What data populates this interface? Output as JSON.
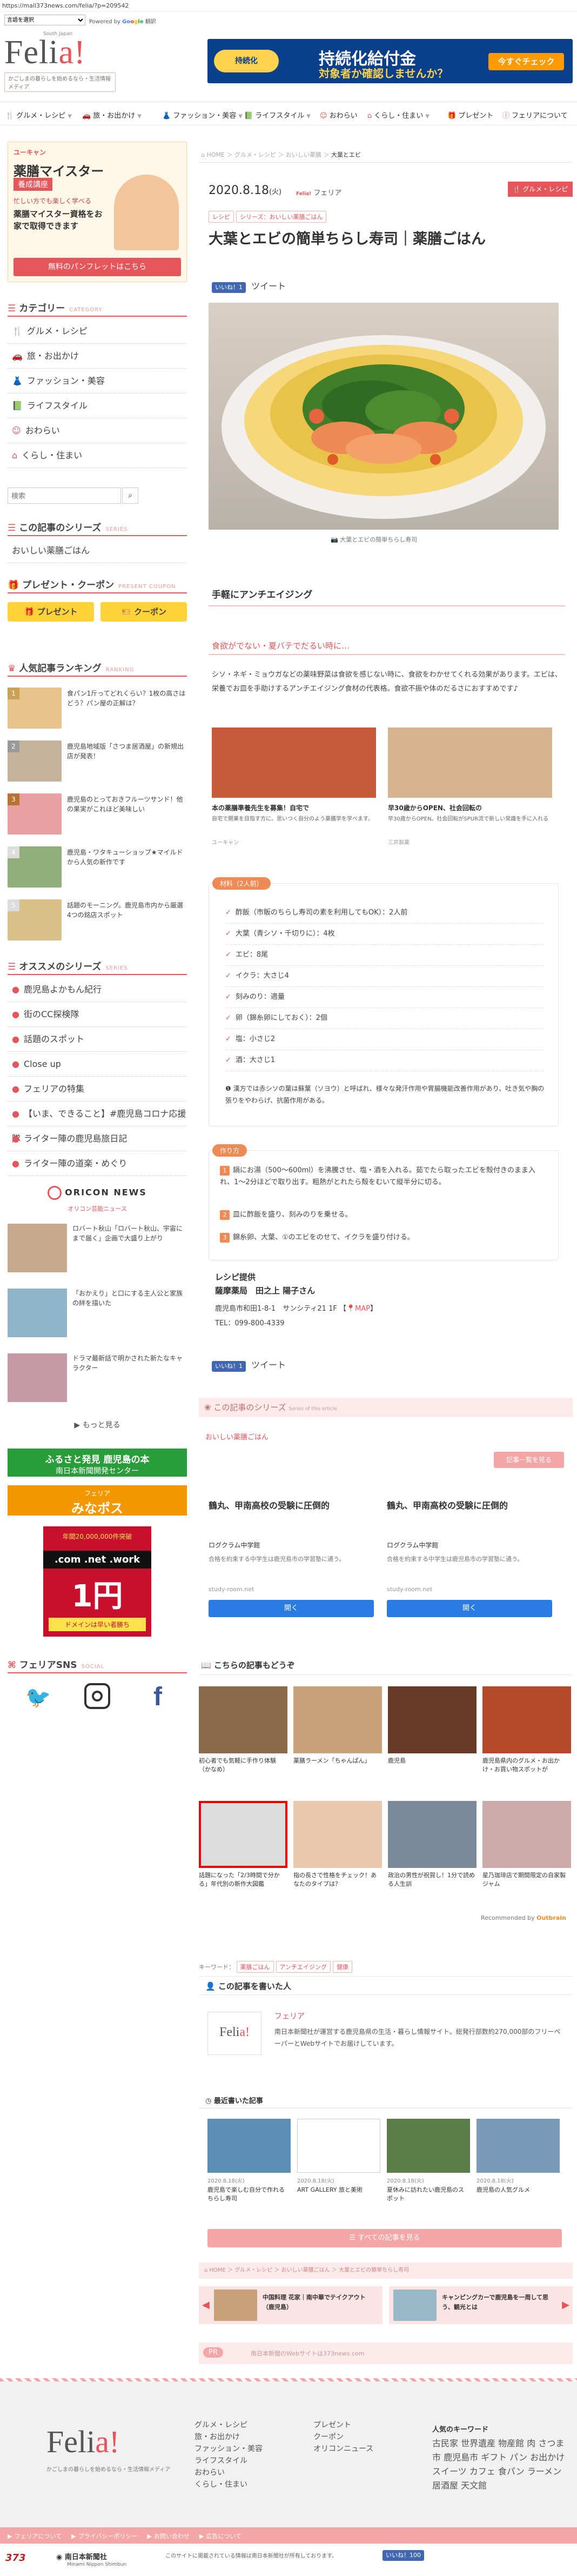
{
  "browser": {
    "url": "https://mall373news.com/felia/?p=209542"
  },
  "lang": {
    "selected": "言語を選択",
    "powered": "Powered by",
    "translate": "翻訳"
  },
  "header": {
    "logo_text_main": "Feli",
    "logo_text_accent": "a!",
    "logo_small": "South Japan",
    "tagline": "かごしまの暮らしを始めるなら・生活情報メディア",
    "ad": {
      "badge": "持続化",
      "title": "持続化給付金",
      "subtitle": "対象者か確認しませんか？",
      "cta": "今すぐチェック"
    }
  },
  "nav": [
    {
      "label": "グルメ・レシピ"
    },
    {
      "label": "旅・お出かけ"
    },
    {
      "label": "ファッション・美容"
    },
    {
      "label": "ライフスタイル"
    },
    {
      "label": "おわらい"
    },
    {
      "label": "くらし・住まい"
    },
    {
      "label": "プレゼント"
    },
    {
      "label": "フェリアについて"
    }
  ],
  "sidebar": {
    "ad1": {
      "brand": "ユーキャン",
      "title": "薬膳マイスター",
      "sub": "養成講座",
      "catch": "忙しい方でも楽しく学べる",
      "line": "薬膳マイスター資格をお家で取得できます",
      "cta": "無料のパンフレットはこちら"
    },
    "category_title": "カテゴリー",
    "category_sub": "CATEGORY",
    "categories": [
      "グルメ・レシピ",
      "旅・お出かけ",
      "ファッション・美容",
      "ライフスタイル",
      "おわらい",
      "くらし・住まい"
    ],
    "search_placeholder": "検索",
    "series_title": "この記事のシリーズ",
    "series_sub": "SERIES",
    "series_items": [
      "おいしい薬膳ごはん"
    ],
    "present_title": "プレゼント・クーポン",
    "present_sub": "PRESENT COUPON",
    "present_btn": "プレゼント",
    "coupon_btn": "クーポン",
    "ranking_title": "人気記事ランキング",
    "ranking_sub": "RANKING",
    "ranking": [
      {
        "rank": "1",
        "text": "食パン1斤ってどれくらい？1枚の高さはどう？パン屋の正解は？"
      },
      {
        "rank": "2",
        "text": "鹿児島地域版「さつま居酒屋」の新規出店が発表！"
      },
      {
        "rank": "3",
        "text": "鹿児島のとっておきフルーツサンド！他の果実がこれほど美味しい"
      },
      {
        "rank": "4",
        "text": "鹿児島・ワタキューショップ★マイルドから人気の新作です"
      },
      {
        "rank": "5",
        "text": "話題のモーニング。鹿児島市内から厳選4つの銘店スポット"
      }
    ],
    "series_rec_title": "オススメのシリーズ",
    "series_rec_sub": "SERIES",
    "series_rec": [
      "鹿児島よかもん紀行",
      "街のCC探検隊",
      "話題のスポット",
      "Close up",
      "フェリアの特集",
      "【いま、できること】#鹿児島コロナ応援隊",
      "ライター陣の鹿児島旅日記",
      "ライター陣の道楽・めぐり"
    ],
    "oricon_title": "ORICON NEWS",
    "oricon_sub": "オリコン芸能ニュース",
    "oricon": [
      {
        "text": "ロバート秋山「ロバート秋山、宇宙にまで届く」企画で大盛り上がり"
      },
      {
        "text": "「おかえり」と口にする主人公と家族の絆を描いた"
      },
      {
        "text": "ドラマ最新話で明かされた新たなキャラクター"
      }
    ],
    "more": "もっと見る",
    "banner1": {
      "line1": "ふるさと発見 鹿児島の本",
      "line2": "南日本新聞開発センター"
    },
    "banner2": {
      "line1": "フェリア",
      "line2": "みなポス"
    },
    "banner3": {
      "line1": "年間20,000,000件突破",
      "line2": ".com .net .work",
      "line3": "1円",
      "line4": "ドメインは早い者勝ち"
    },
    "sns_title": "フェリアSNS",
    "sns_sub": "SOCIAL"
  },
  "article": {
    "breadcrumb": [
      "HOME",
      "グルメ・レシピ",
      "おいしい薬膳",
      "大葉とエビ"
    ],
    "date": "2020.8.18",
    "dow": "(火)",
    "author": "フェリア",
    "badge": "グルメ・レシピ",
    "tags_top": [
      "レシピ",
      "シリーズ：おいしい薬膳ごはん"
    ],
    "title": "大葉とエビの簡単ちらし寿司｜薬膳ごはん",
    "like": "いいね！1",
    "tweet": "ツイート",
    "image_caption": "大葉とエビの簡単ちらし寿司",
    "section_title": "手軽にアンチエイジング",
    "intro_heading": "食欲がでない・夏バテでだるい時に…",
    "intro": "シソ・ネギ・ミョウガなどの薬味野菜は食欲を感じない時に、食欲をわかせてくれる効果があります。エビは、栄養でお皿を手助けするアンチエイジング食材の代表格。食欲不振や体のだるさにおすすめです♪",
    "ad_cards": [
      {
        "title": "本の薬膳準養先生を募集！自宅で",
        "text": "自宅で開業を目指す方に。思いつく自分のよう薬膳学を学べます。",
        "src": "ユーキャン"
      },
      {
        "title": "早30歳からOPEN、社会回転の",
        "text": "早30歳からOPEN。社会回転がSPUR流で新しい常識を手に入れる",
        "src": "三井製薬"
      }
    ],
    "ingredients_label": "材料（2人前）",
    "ingredients": [
      "酢飯（市販のちらし寿司の素を利用してもOK）：2人前",
      "大葉（青シソ・千切りに）：4枚",
      "エビ：8尾",
      "イクラ：大さじ4",
      "刻みのり：適量",
      "卵（錦糸卵にしておく）：2個",
      "塩：小さじ2",
      "酒：大さじ1"
    ],
    "note": "漢方では赤シソの葉は蘇葉（ソヨウ）と呼ばれ、様々な発汗作用や胃腸機能改善作用があり、吐き気や胸の張りをやわらげ、抗菌作用がある。",
    "steps_label": "作り方",
    "steps": [
      "鍋にお湯（500〜600ml）を沸騰させ、塩・酒を入れる。茹でたら取ったエビを殻付きのまま入れ、1〜2分ほどで取り出す。粗熱がとれたら殻をむいて縦半分に切る。",
      "皿に酢飯を盛り、刻みのりを乗せる。",
      "錦糸卵、大葉、①のエビをのせて、イクラを盛り付ける。"
    ],
    "provider_label": "レシピ提供",
    "provider": "薩摩薬局　田之上 陽子さん",
    "address": "鹿児島市和田1-8-1　サンシティ21 1F",
    "map": "MAP",
    "tel": "TEL：099-800-4339",
    "series_bar": "この記事のシリーズ",
    "series_bar_sub": "Series of this article",
    "series_name": "おいしい薬膳ごはん",
    "series_btn": "記事一覧を見る",
    "ads2": [
      {
        "title": "鶴丸、甲南高校の受験に圧倒的",
        "sub": "ログクラム中学館",
        "text": "合格を約束する中学生は鹿児島市の学習塾に通う。",
        "src": "study-room.net",
        "cta": "開く"
      },
      {
        "title": "鶴丸、甲南高校の受験に圧倒的",
        "sub": "ログクラム中学館",
        "text": "合格を約束する中学生は鹿児島市の学習塾に通う。",
        "src": "study-room.net",
        "cta": "開く"
      }
    ],
    "reco_title": "こちらの記事もどうぞ",
    "reco": [
      {
        "text": "初心者でも気軽に手作り体験（かなめ）"
      },
      {
        "text": "薬膳ラーメン「ちゃんぱん」"
      },
      {
        "text": "鹿児島"
      },
      {
        "text": "鹿児島県内のグルメ・お出かけ・お買い物スポットが"
      },
      {
        "text": "話題になった「2/3時間で分かる」年代別の新作大図鑑"
      },
      {
        "text": "指の長さで性格をチェック！あなたのタイプは？"
      },
      {
        "text": "政治の男性が祝賀し！1分で読める人生訓"
      },
      {
        "text": "星乃珈琲店で期間限定の自家製ジャム"
      }
    ],
    "outbrain": "Recommended by",
    "keyword_label": "キーワード：",
    "keywords": [
      "薬膳ごはん",
      "アンチエイジング",
      "健康"
    ],
    "writer_title": "この記事を書いた人",
    "writer_name": "フェリア",
    "writer_text": "南日本新聞社が運営する鹿児島県の生活・暮らし情報サイト。総発行部数約270,000部のフリーペーパーとWebサイトでお届けしています。",
    "recent_title": "最近書いた記事",
    "recent": [
      {
        "date": "2020.8.18(火)",
        "text": "鹿児島で楽しむ自分で作れるちらし寿司"
      },
      {
        "date": "2020.8.18(火)",
        "text": "ART GALLERY 旅と美術"
      },
      {
        "date": "2020.8.18(火)",
        "text": "夏休みに訪れたい鹿児島のスポット"
      },
      {
        "date": "2020.8.18(火)",
        "text": "鹿児島の人気グルメ"
      }
    ],
    "recent_btn": "すべての記事を見る",
    "bottom_crumb": [
      "HOME",
      "グルメ・レシピ",
      "おいしい薬膳ごはん",
      "大葉とエビの簡単ちらし寿司"
    ],
    "prev": "中国料理 花家｜南中華でテイクアウト（鹿児島）",
    "next": "キャンピングカーで鹿児島を一周して思う、観光とは",
    "pr_label": "PR",
    "pr_text": "南日本新聞のWebサイトは373news.com"
  },
  "footer": {
    "logo_main": "Feli",
    "logo_accent": "a!",
    "tagline": "かごしまの暮らしを始めるなら・生活情報メディア",
    "col1": [
      "グルメ・レシピ",
      "旅・お出かけ",
      "ファッション・美容",
      "ライフスタイル",
      "おわらい",
      "くらし・住まい"
    ],
    "col2": [
      "プレゼント",
      "クーポン",
      "オリコンニュース"
    ],
    "kw_title": "人気のキーワード",
    "kw_text": "古民家 世界遺産 物産館 肉 さつま 市 鹿児島市 ギフト パン お出かけ スイーツ カフェ 食パン ラーメン 居酒屋 天文館",
    "links": [
      "フェリアについて",
      "プライバシーポリシー",
      "お問い合わせ",
      "広告について"
    ],
    "publisher": "南日本新聞社",
    "publisher_sub": "Minami Nippon Shimbun",
    "copyright": "このサイトに掲載されている情報は南日本新聞社が所有しております。",
    "share": "いいね！100"
  }
}
